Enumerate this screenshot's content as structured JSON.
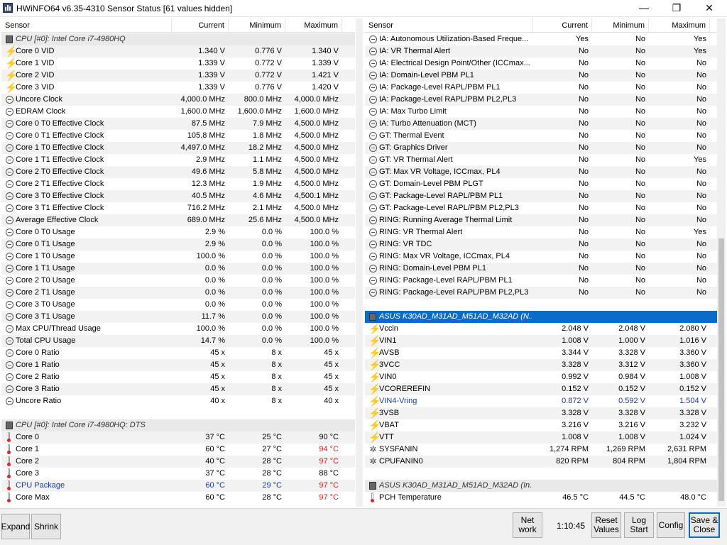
{
  "window": {
    "title": "HWiNFO64 v6.35-4310 Sensor Status [61 values hidden]",
    "min": "—",
    "max": "❐",
    "close": "✕"
  },
  "columns": {
    "sensor": "Sensor",
    "current": "Current",
    "minimum": "Minimum",
    "maximum": "Maximum"
  },
  "left_rows": [
    {
      "t": "group",
      "icon": "chip",
      "name": "CPU [#0]: Intel Core i7-4980HQ"
    },
    {
      "icon": "volt",
      "name": "Core 0 VID",
      "cur": "1.340 V",
      "min": "0.776 V",
      "max": "1.340 V"
    },
    {
      "icon": "volt",
      "name": "Core 1 VID",
      "cur": "1.339 V",
      "min": "0.772 V",
      "max": "1.339 V"
    },
    {
      "icon": "volt",
      "name": "Core 2 VID",
      "cur": "1.339 V",
      "min": "0.772 V",
      "max": "1.421 V"
    },
    {
      "icon": "volt",
      "name": "Core 3 VID",
      "cur": "1.339 V",
      "min": "0.776 V",
      "max": "1.420 V"
    },
    {
      "icon": "clock",
      "name": "Uncore Clock",
      "cur": "4,000.0 MHz",
      "min": "800.0 MHz",
      "max": "4,000.0 MHz"
    },
    {
      "icon": "clock",
      "name": "EDRAM Clock",
      "cur": "1,600.0 MHz",
      "min": "1,600.0 MHz",
      "max": "1,600.0 MHz"
    },
    {
      "icon": "clock",
      "name": "Core 0 T0 Effective Clock",
      "cur": "87.5 MHz",
      "min": "7.9 MHz",
      "max": "4,500.0 MHz"
    },
    {
      "icon": "clock",
      "name": "Core 0 T1 Effective Clock",
      "cur": "105.8 MHz",
      "min": "1.8 MHz",
      "max": "4,500.0 MHz"
    },
    {
      "icon": "clock",
      "name": "Core 1 T0 Effective Clock",
      "cur": "4,497.0 MHz",
      "min": "18.2 MHz",
      "max": "4,500.0 MHz"
    },
    {
      "icon": "clock",
      "name": "Core 1 T1 Effective Clock",
      "cur": "2.9 MHz",
      "min": "1.1 MHz",
      "max": "4,500.0 MHz"
    },
    {
      "icon": "clock",
      "name": "Core 2 T0 Effective Clock",
      "cur": "49.6 MHz",
      "min": "5.8 MHz",
      "max": "4,500.0 MHz"
    },
    {
      "icon": "clock",
      "name": "Core 2 T1 Effective Clock",
      "cur": "12.3 MHz",
      "min": "1.9 MHz",
      "max": "4,500.0 MHz"
    },
    {
      "icon": "clock",
      "name": "Core 3 T0 Effective Clock",
      "cur": "40.5 MHz",
      "min": "4.6 MHz",
      "max": "4,500.1 MHz"
    },
    {
      "icon": "clock",
      "name": "Core 3 T1 Effective Clock",
      "cur": "716.2 MHz",
      "min": "2.1 MHz",
      "max": "4,500.0 MHz"
    },
    {
      "icon": "clock",
      "name": "Average Effective Clock",
      "cur": "689.0 MHz",
      "min": "25.6 MHz",
      "max": "4,500.0 MHz"
    },
    {
      "icon": "clock",
      "name": "Core 0 T0 Usage",
      "cur": "2.9 %",
      "min": "0.0 %",
      "max": "100.0 %"
    },
    {
      "icon": "clock",
      "name": "Core 0 T1 Usage",
      "cur": "2.9 %",
      "min": "0.0 %",
      "max": "100.0 %"
    },
    {
      "icon": "clock",
      "name": "Core 1 T0 Usage",
      "cur": "100.0 %",
      "min": "0.0 %",
      "max": "100.0 %"
    },
    {
      "icon": "clock",
      "name": "Core 1 T1 Usage",
      "cur": "0.0 %",
      "min": "0.0 %",
      "max": "100.0 %"
    },
    {
      "icon": "clock",
      "name": "Core 2 T0 Usage",
      "cur": "0.0 %",
      "min": "0.0 %",
      "max": "100.0 %"
    },
    {
      "icon": "clock",
      "name": "Core 2 T1 Usage",
      "cur": "0.0 %",
      "min": "0.0 %",
      "max": "100.0 %"
    },
    {
      "icon": "clock",
      "name": "Core 3 T0 Usage",
      "cur": "0.0 %",
      "min": "0.0 %",
      "max": "100.0 %"
    },
    {
      "icon": "clock",
      "name": "Core 3 T1 Usage",
      "cur": "11.7 %",
      "min": "0.0 %",
      "max": "100.0 %"
    },
    {
      "icon": "clock",
      "name": "Max CPU/Thread Usage",
      "cur": "100.0 %",
      "min": "0.0 %",
      "max": "100.0 %"
    },
    {
      "icon": "clock",
      "name": "Total CPU Usage",
      "cur": "14.7 %",
      "min": "0.0 %",
      "max": "100.0 %"
    },
    {
      "icon": "clock",
      "name": "Core 0 Ratio",
      "cur": "45 x",
      "min": "8 x",
      "max": "45 x"
    },
    {
      "icon": "clock",
      "name": "Core 1 Ratio",
      "cur": "45 x",
      "min": "8 x",
      "max": "45 x"
    },
    {
      "icon": "clock",
      "name": "Core 2 Ratio",
      "cur": "45 x",
      "min": "8 x",
      "max": "45 x"
    },
    {
      "icon": "clock",
      "name": "Core 3 Ratio",
      "cur": "45 x",
      "min": "8 x",
      "max": "45 x"
    },
    {
      "icon": "clock",
      "name": "Uncore Ratio",
      "cur": "40 x",
      "min": "8 x",
      "max": "40 x"
    },
    {
      "t": "blank"
    },
    {
      "t": "group",
      "icon": "chip",
      "name": "CPU [#0]: Intel Core i7-4980HQ: DTS"
    },
    {
      "icon": "temp",
      "name": "Core 0",
      "cur": "37 °C",
      "min": "25 °C",
      "max": "90 °C"
    },
    {
      "icon": "temp",
      "name": "Core 1",
      "cur": "60 °C",
      "min": "27 °C",
      "max": "94 °C",
      "maxc": "red"
    },
    {
      "icon": "temp",
      "name": "Core 2",
      "cur": "40 °C",
      "min": "28 °C",
      "max": "97 °C",
      "maxc": "red"
    },
    {
      "icon": "temp",
      "name": "Core 3",
      "cur": "37 °C",
      "min": "28 °C",
      "max": "88 °C"
    },
    {
      "icon": "temp",
      "name": "CPU Package",
      "cur": "60 °C",
      "min": "29 °C",
      "max": "97 °C",
      "namec": "blue",
      "curc": "blue",
      "minc": "blue",
      "maxc": "red"
    },
    {
      "icon": "temp",
      "name": "Core Max",
      "cur": "60 °C",
      "min": "28 °C",
      "max": "97 °C",
      "maxc": "red"
    }
  ],
  "right_rows": [
    {
      "icon": "clock",
      "name": "IA: Autonomous Utilization-Based Freque...",
      "cur": "Yes",
      "min": "No",
      "max": "Yes"
    },
    {
      "icon": "clock",
      "name": "IA: VR Thermal Alert",
      "cur": "No",
      "min": "No",
      "max": "Yes"
    },
    {
      "icon": "clock",
      "name": "IA: Electrical Design Point/Other (ICCmax...",
      "cur": "No",
      "min": "No",
      "max": "No"
    },
    {
      "icon": "clock",
      "name": "IA: Domain-Level PBM PL1",
      "cur": "No",
      "min": "No",
      "max": "No"
    },
    {
      "icon": "clock",
      "name": "IA: Package-Level RAPL/PBM PL1",
      "cur": "No",
      "min": "No",
      "max": "No"
    },
    {
      "icon": "clock",
      "name": "IA: Package-Level RAPL/PBM PL2,PL3",
      "cur": "No",
      "min": "No",
      "max": "No"
    },
    {
      "icon": "clock",
      "name": "IA: Max Turbo Limit",
      "cur": "No",
      "min": "No",
      "max": "No"
    },
    {
      "icon": "clock",
      "name": "IA: Turbo Attenuation (MCT)",
      "cur": "No",
      "min": "No",
      "max": "No"
    },
    {
      "icon": "clock",
      "name": "GT: Thermal Event",
      "cur": "No",
      "min": "No",
      "max": "No"
    },
    {
      "icon": "clock",
      "name": "GT: Graphics Driver",
      "cur": "No",
      "min": "No",
      "max": "No"
    },
    {
      "icon": "clock",
      "name": "GT: VR Thermal Alert",
      "cur": "No",
      "min": "No",
      "max": "Yes"
    },
    {
      "icon": "clock",
      "name": "GT: Max VR Voltage, ICCmax, PL4",
      "cur": "No",
      "min": "No",
      "max": "No"
    },
    {
      "icon": "clock",
      "name": "GT: Domain-Level PBM PLGT",
      "cur": "No",
      "min": "No",
      "max": "No"
    },
    {
      "icon": "clock",
      "name": "GT: Package-Level RAPL/PBM PL1",
      "cur": "No",
      "min": "No",
      "max": "No"
    },
    {
      "icon": "clock",
      "name": "GT: Package-Level RAPL/PBM PL2,PL3",
      "cur": "No",
      "min": "No",
      "max": "No"
    },
    {
      "icon": "clock",
      "name": "RING: Running Average Thermal Limit",
      "cur": "No",
      "min": "No",
      "max": "No"
    },
    {
      "icon": "clock",
      "name": "RING: VR Thermal Alert",
      "cur": "No",
      "min": "No",
      "max": "Yes"
    },
    {
      "icon": "clock",
      "name": "RING: VR TDC",
      "cur": "No",
      "min": "No",
      "max": "No"
    },
    {
      "icon": "clock",
      "name": "RING: Max VR Voltage, ICCmax, PL4",
      "cur": "No",
      "min": "No",
      "max": "No"
    },
    {
      "icon": "clock",
      "name": "RING: Domain-Level PBM PL1",
      "cur": "No",
      "min": "No",
      "max": "No"
    },
    {
      "icon": "clock",
      "name": "RING: Package-Level RAPL/PBM PL1",
      "cur": "No",
      "min": "No",
      "max": "No"
    },
    {
      "icon": "clock",
      "name": "RING: Package-Level RAPL/PBM PL2,PL3",
      "cur": "No",
      "min": "No",
      "max": "No"
    },
    {
      "t": "blank"
    },
    {
      "t": "sel",
      "icon": "chip",
      "name": "ASUS K30AD_M31AD_M51AD_M32AD (N..."
    },
    {
      "icon": "volt",
      "name": "Vccin",
      "cur": "2.048 V",
      "min": "2.048 V",
      "max": "2.080 V"
    },
    {
      "icon": "volt",
      "name": "VIN1",
      "cur": "1.008 V",
      "min": "1.000 V",
      "max": "1.016 V"
    },
    {
      "icon": "volt",
      "name": "AVSB",
      "cur": "3.344 V",
      "min": "3.328 V",
      "max": "3.360 V"
    },
    {
      "icon": "volt",
      "name": "3VCC",
      "cur": "3.328 V",
      "min": "3.312 V",
      "max": "3.360 V"
    },
    {
      "icon": "volt",
      "name": "VIN0",
      "cur": "0.992 V",
      "min": "0.984 V",
      "max": "1.008 V"
    },
    {
      "icon": "volt",
      "name": "VCOREREFIN",
      "cur": "0.152 V",
      "min": "0.152 V",
      "max": "0.152 V"
    },
    {
      "icon": "volt",
      "name": "VIN4-Vring",
      "cur": "0.872 V",
      "min": "0.592 V",
      "max": "1.504 V",
      "namec": "blue",
      "curc": "blue",
      "minc": "blue",
      "maxc": "blue"
    },
    {
      "icon": "volt",
      "name": "3VSB",
      "cur": "3.328 V",
      "min": "3.328 V",
      "max": "3.328 V"
    },
    {
      "icon": "volt",
      "name": "VBAT",
      "cur": "3.216 V",
      "min": "3.216 V",
      "max": "3.232 V"
    },
    {
      "icon": "volt",
      "name": "VTT",
      "cur": "1.008 V",
      "min": "1.008 V",
      "max": "1.024 V"
    },
    {
      "icon": "fan",
      "name": "SYSFANIN",
      "cur": "1,274 RPM",
      "min": "1,269 RPM",
      "max": "2,631 RPM"
    },
    {
      "icon": "fan",
      "name": "CPUFANIN0",
      "cur": "820 RPM",
      "min": "804 RPM",
      "max": "1,804 RPM"
    },
    {
      "t": "blank"
    },
    {
      "t": "group",
      "icon": "chip",
      "name": "ASUS K30AD_M31AD_M51AD_M32AD (In..."
    },
    {
      "icon": "temp",
      "name": "PCH Temperature",
      "cur": "46.5 °C",
      "min": "44.5 °C",
      "max": "48.0 °C"
    }
  ],
  "bottom": {
    "expand": "Expand",
    "shrink": "Shrink",
    "net_work": "Net\nwork",
    "timer": "1:10:45",
    "reset_values": "Reset\nValues",
    "log_start": "Log\nStart",
    "config": "Config",
    "save_close": "Save &\nClose"
  },
  "colors": {
    "selection": "#0a6bc8",
    "alert_red": "#e02020",
    "highlight_blue": "#1a3aa8"
  }
}
